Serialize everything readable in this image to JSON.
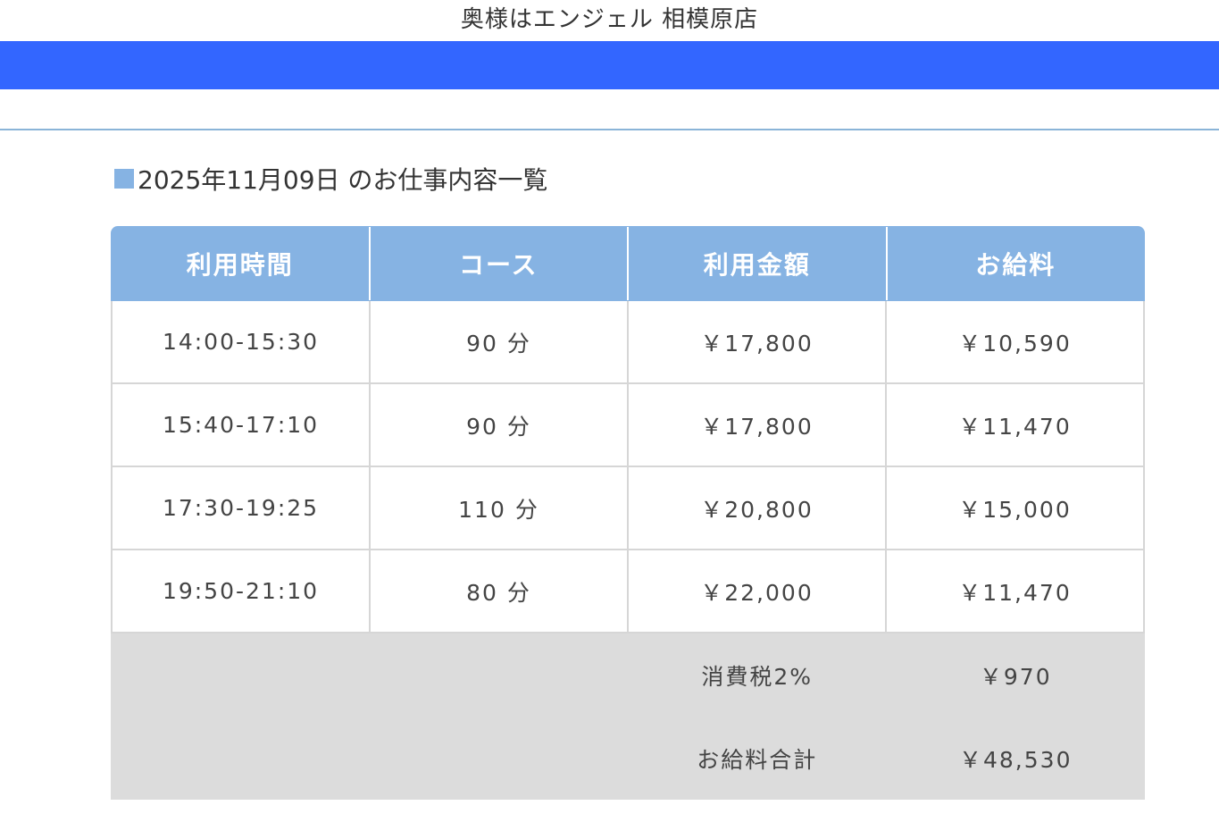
{
  "store": {
    "title": "奥様はエンジェル 相模原店"
  },
  "section": {
    "title": "2025年11月09日 のお仕事内容一覧"
  },
  "colors": {
    "bar": "#3366ff",
    "header": "#86b3e3",
    "summary_bg": "#dcdcdc"
  },
  "table": {
    "headers": [
      "利用時間",
      "コース",
      "利用金額",
      "お給料"
    ],
    "rows": [
      {
        "time": "14:00-15:30",
        "course": "90 分",
        "amount": "￥17,800",
        "pay": "￥10,590"
      },
      {
        "time": "15:40-17:10",
        "course": "90 分",
        "amount": "￥17,800",
        "pay": "￥11,470"
      },
      {
        "time": "17:30-19:25",
        "course": "110 分",
        "amount": "￥20,800",
        "pay": "￥15,000"
      },
      {
        "time": "19:50-21:10",
        "course": "80 分",
        "amount": "￥22,000",
        "pay": "￥11,470"
      }
    ]
  },
  "summary": {
    "tax_label": "消費税2%",
    "tax_value": "￥970",
    "total_label": "お給料合計",
    "total_value": "￥48,530"
  }
}
